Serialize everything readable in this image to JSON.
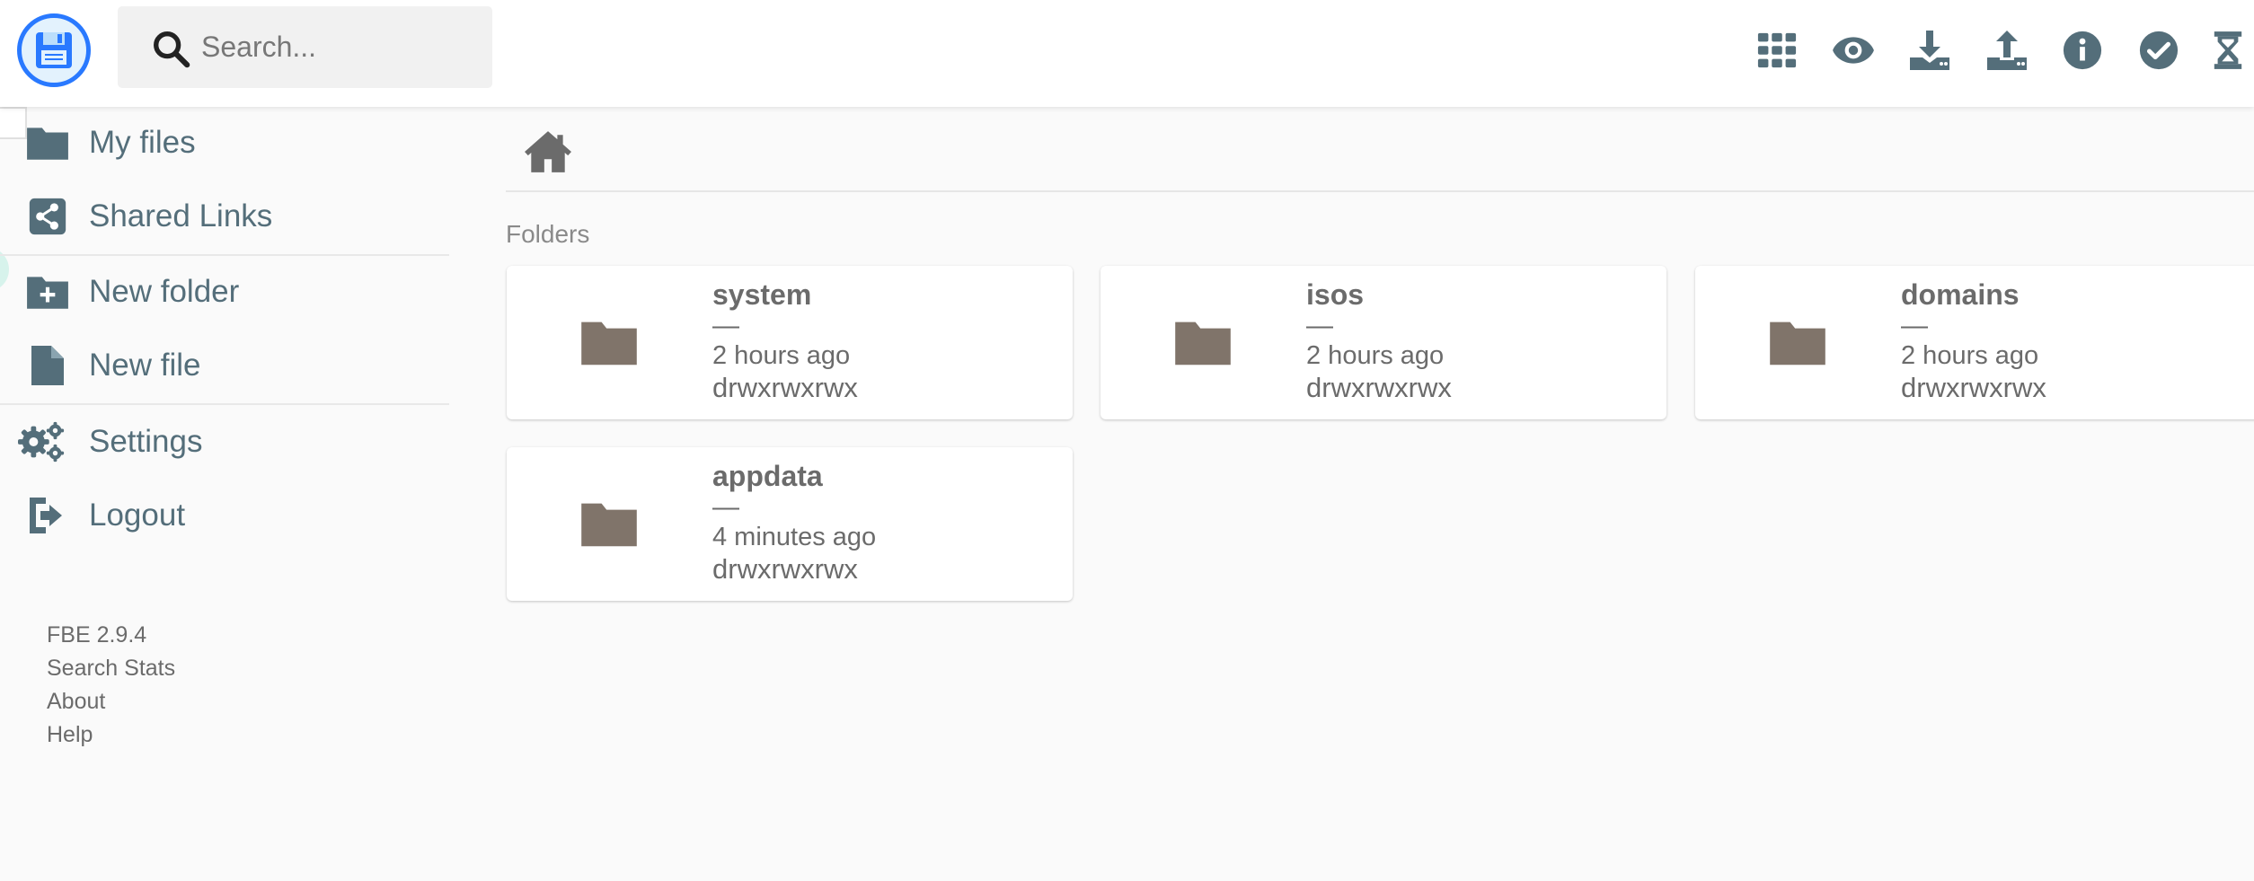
{
  "header": {
    "search_placeholder": "Search...",
    "actions": [
      {
        "icon": "grid-view-icon"
      },
      {
        "icon": "eye-icon"
      },
      {
        "icon": "download-icon"
      },
      {
        "icon": "upload-icon"
      },
      {
        "icon": "info-icon"
      },
      {
        "icon": "check-circle-icon"
      },
      {
        "icon": "hourglass-icon"
      }
    ]
  },
  "sidebar": {
    "items": [
      {
        "label": "My files",
        "icon": "folder-icon"
      },
      {
        "label": "Shared Links",
        "icon": "share-icon"
      },
      {
        "label": "New folder",
        "icon": "create-new-folder-icon"
      },
      {
        "label": "New file",
        "icon": "file-icon"
      },
      {
        "label": "Settings",
        "icon": "settings-gears-icon"
      },
      {
        "label": "Logout",
        "icon": "logout-icon"
      }
    ],
    "credits": {
      "version": "FBE 2.9.4",
      "links": [
        "Search Stats",
        "About",
        "Help"
      ]
    }
  },
  "main": {
    "section_title": "Folders",
    "folders": [
      {
        "name": "system",
        "size": "—",
        "modified": "2 hours ago",
        "permissions": "drwxrwxrwx"
      },
      {
        "name": "isos",
        "size": "—",
        "modified": "2 hours ago",
        "permissions": "drwxrwxrwx"
      },
      {
        "name": "domains",
        "size": "—",
        "modified": "2 hours ago",
        "permissions": "drwxrwxrwx"
      },
      {
        "name": "appdata",
        "size": "—",
        "modified": "4 minutes ago",
        "permissions": "drwxrwxrwx"
      }
    ]
  },
  "colors": {
    "accent": "#2979ff",
    "icon": "#546e7a",
    "folder": "#80746a",
    "text": "#6b6b6b"
  }
}
